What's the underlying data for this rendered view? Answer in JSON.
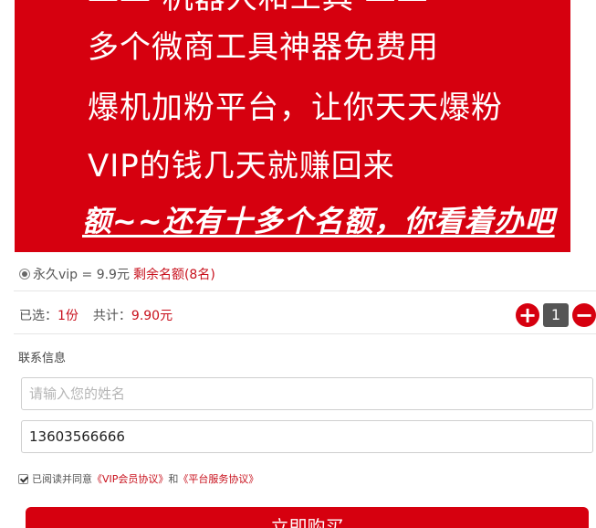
{
  "banner": {
    "line0": "—— 机器人和工具 ——",
    "line1": "多个微商工具神器免费用",
    "line2": "爆机加粉平台，让你天天爆粉",
    "line3": "VIP的钱几天就赚回来",
    "line4": "额~~还有十多个名额，你看着办吧"
  },
  "option": {
    "label": "永久vip = 9.9元",
    "remaining": "剩余名额(8名)"
  },
  "summary": {
    "selected_label": "已选：",
    "selected_count": "1份",
    "total_label": "共计：",
    "total_value": "9.90元"
  },
  "stepper": {
    "plus": "+",
    "quantity": "1",
    "minus": "−"
  },
  "contact": {
    "title": "联系信息",
    "name_placeholder": "请输入您的姓名",
    "phone_value": "13603566666"
  },
  "agreement": {
    "prefix": "已阅读并同意",
    "vip_link": "《VIP会员协议》",
    "and": "和",
    "platform_link": "《平台服务协议》"
  },
  "buy_button": "立即购买",
  "colors": {
    "brand_red": "#d6000f",
    "text_red": "#c8101c"
  }
}
